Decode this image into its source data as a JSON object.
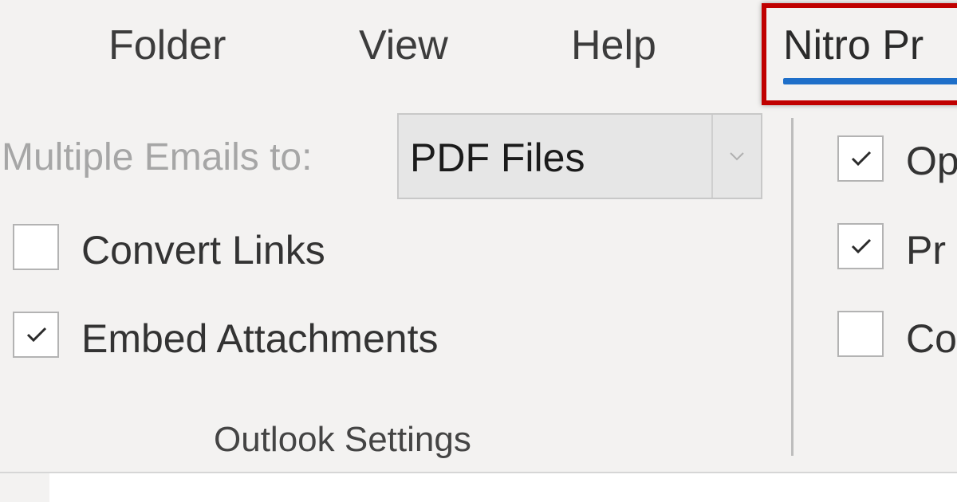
{
  "tabs": {
    "folder": "Folder",
    "view": "View",
    "help": "Help",
    "nitro": "Nitro Pr"
  },
  "outlook_settings": {
    "multi_label": "Multiple Emails to:",
    "select_value": "PDF Files",
    "checkboxes": [
      {
        "label": "Convert Links",
        "checked": false
      },
      {
        "label": "Embed Attachments",
        "checked": true
      }
    ],
    "group_title": "Outlook Settings"
  },
  "right_group": {
    "items": [
      {
        "label": "Op",
        "checked": true
      },
      {
        "label": "Pr",
        "checked": true
      },
      {
        "label": "Co",
        "checked": false
      }
    ]
  },
  "colors": {
    "highlight_border": "#c00000",
    "active_tab_underline": "#1e6fc9",
    "ribbon_bg": "#f3f2f1"
  },
  "icons": {
    "select_arrow": "chevron-down-icon",
    "check": "checkmark-icon"
  }
}
